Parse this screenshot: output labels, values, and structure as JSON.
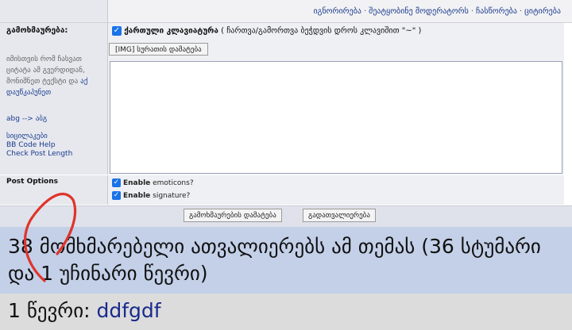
{
  "topbar": {
    "links": [
      "იგნორირება",
      "შეატყობინე მოდერატორს",
      "ჩასწორება",
      "ციტირება"
    ],
    "separator": "·"
  },
  "form": {
    "label": "გამოხმაურება:",
    "hint_text": "იმისთვის რომ ჩასვათ ციტატა ამ გვერდიდან, მონიშნეთ ტექსტი და",
    "hint_link": "აქ დაუწკაპუნეთ",
    "abg_link": "abg --> აბგ",
    "smileys_link": "სიცილაკები",
    "bbcode_link": "BB Code Help",
    "check_length_link": "Check Post Length",
    "keyboard_label": "ქართული კლავიატურა",
    "keyboard_note": "( ჩართვა/გამორთვა ბეჭდვის დროს კლავიშით \"~\" )",
    "img_button": "[IMG] სურათის დამატება",
    "message_value": ""
  },
  "post_options": {
    "label": "Post Options",
    "emoticons_bold": "Enable",
    "emoticons_rest": " emoticons?",
    "signature_bold": "Enable",
    "signature_rest": " signature?"
  },
  "buttons": {
    "submit": "გამოხმაურების დამატება",
    "preview": "გადათვალიერება"
  },
  "viewers_text": "38 მომხმარებელი ათვალიერებს ამ თემას (36 სტუმარი და 1 უჩინარი წევრი)",
  "members": {
    "prefix": "1 წევრი: ",
    "name": "ddfgdf"
  },
  "colors": {
    "checkbox": "#1a73e8",
    "link": "#1a3a8c",
    "viewers_bg": "#c3d0e8",
    "annotation": "#e0342a"
  }
}
